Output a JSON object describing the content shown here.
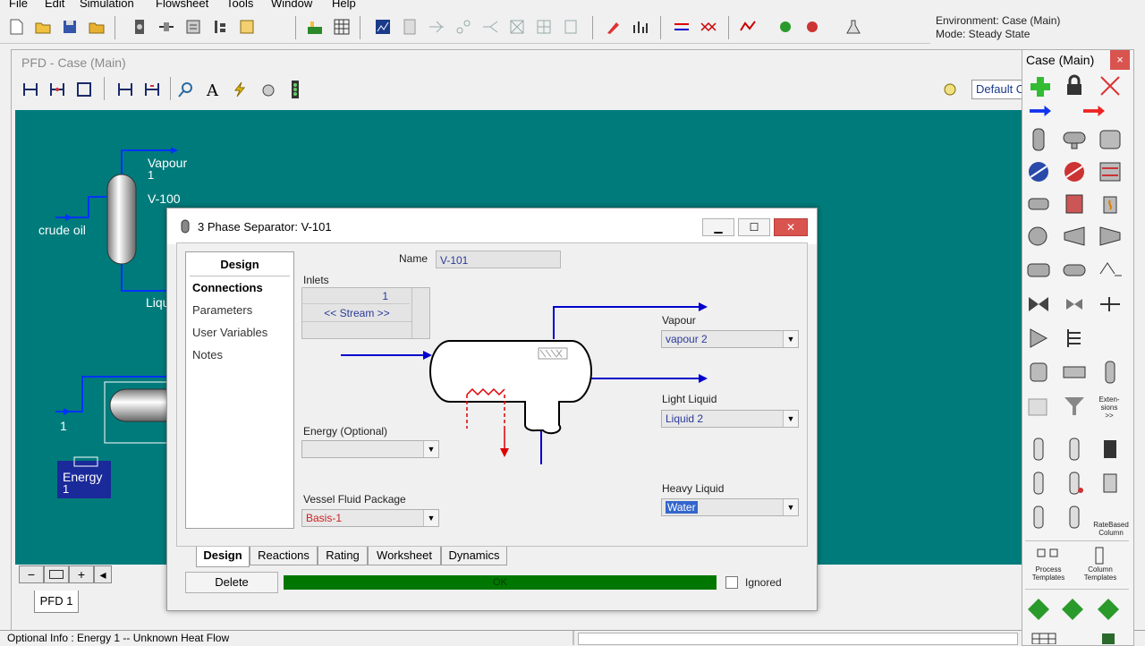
{
  "menu": [
    "File",
    "Edit",
    "Simulation",
    "Flowsheet",
    "Tools",
    "Window",
    "Help"
  ],
  "environment": {
    "line1": "Environment: Case (Main)",
    "line2": "Mode: Steady State"
  },
  "pfd": {
    "title": "PFD - Case (Main)",
    "default_label": "Default C",
    "tab": "PFD 1",
    "canvas_labels": {
      "vapour": "Vapour",
      "vapour_num": "1",
      "v100": "V-100",
      "crude_oil": "crude oil",
      "liquid": "Liqu",
      "stream1": "1",
      "energy": "Energy",
      "energy_num": "1"
    },
    "zoom": {
      "minus": "−",
      "plus": "+",
      "left": "◂"
    }
  },
  "dialog": {
    "title": "3 Phase Separator: V-101",
    "nav_header": "Design",
    "nav_items": [
      "Connections",
      "Parameters",
      "User Variables",
      "Notes"
    ],
    "name_label": "Name",
    "name_value": "V-101",
    "inlets_label": "Inlets",
    "inlet_row1": "1",
    "inlet_row2": "<< Stream >>",
    "energy_label": "Energy (Optional)",
    "energy_value": "",
    "fluid_pkg_label": "Vessel Fluid Package",
    "fluid_pkg_value": "Basis-1",
    "vapour_label": "Vapour",
    "vapour_value": "vapour 2",
    "light_liquid_label": "Light Liquid",
    "light_liquid_value": "Liquid 2",
    "heavy_liquid_label": "Heavy Liquid",
    "heavy_liquid_value": "Water",
    "tabs": [
      "Design",
      "Reactions",
      "Rating",
      "Worksheet",
      "Dynamics"
    ],
    "delete_label": "Delete",
    "status": "OK",
    "ignored_label": "Ignored",
    "colors": {
      "status_ok": "#007700",
      "stream": "#0000cc",
      "energy": "#dd0000"
    }
  },
  "palette": {
    "title": "Case (Main)",
    "close": "×",
    "extensions": "Exten-\nsions\n>>",
    "ratebased": "RateBased\nColumn",
    "process_templates": "Process\nTemplates",
    "column_templates": "Column\nTemplates"
  },
  "status_bar": {
    "text": "Optional Info  : Energy 1 -- Unknown Heat Flow"
  },
  "colors": {
    "canvas": "#007b7b",
    "close_button": "#d9534f"
  }
}
